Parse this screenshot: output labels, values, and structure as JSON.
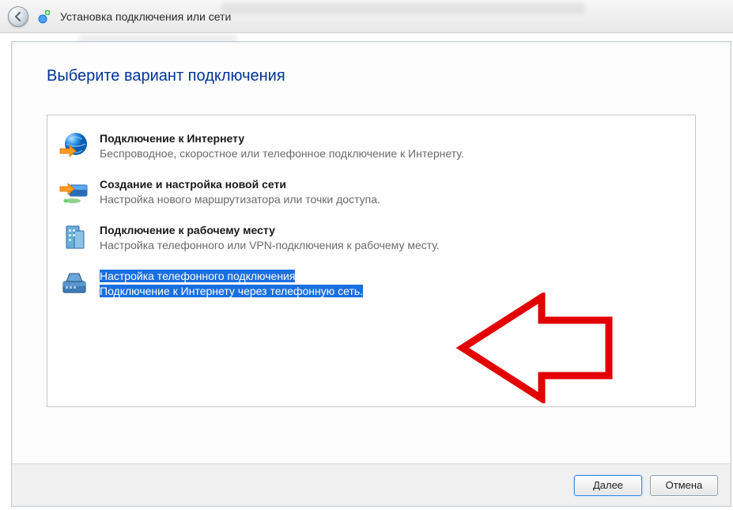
{
  "window": {
    "title": "Установка подключения или сети"
  },
  "page": {
    "heading": "Выберите вариант подключения"
  },
  "options": [
    {
      "title": "Подключение к Интернету",
      "desc": "Беспроводное, скоростное или телефонное подключение к Интернету.",
      "icon": "globe-arrow-icon",
      "selected": false
    },
    {
      "title": "Создание и настройка новой сети",
      "desc": "Настройка нового маршрутизатора или точки доступа.",
      "icon": "router-icon",
      "selected": false
    },
    {
      "title": "Подключение к рабочему месту",
      "desc": "Настройка телефонного или VPN-подключения к рабочему месту.",
      "icon": "building-icon",
      "selected": false
    },
    {
      "title": "Настройка телефонного подключения",
      "desc": "Подключение к Интернету через телефонную сеть.",
      "icon": "dialup-modem-icon",
      "selected": true
    }
  ],
  "buttons": {
    "next": "Далее",
    "cancel": "Отмена"
  }
}
